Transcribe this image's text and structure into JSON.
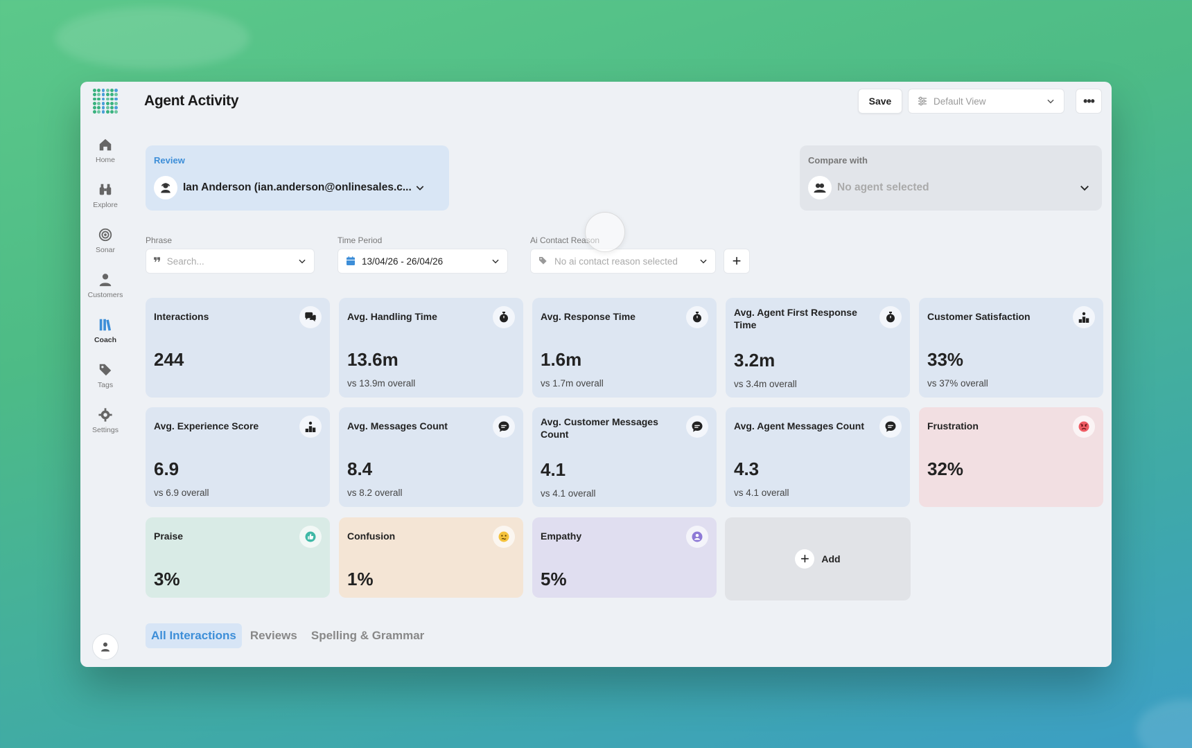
{
  "app": {
    "page_title": "Agent Activity"
  },
  "header": {
    "save_label": "Save",
    "view_label": "Default View",
    "more_label": "•••"
  },
  "sidebar": {
    "items": [
      {
        "label": "Home",
        "icon": "home-icon"
      },
      {
        "label": "Explore",
        "icon": "binoculars-icon"
      },
      {
        "label": "Sonar",
        "icon": "target-icon"
      },
      {
        "label": "Customers",
        "icon": "person-icon"
      },
      {
        "label": "Coach",
        "icon": "books-icon",
        "active": true
      },
      {
        "label": "Tags",
        "icon": "tag-icon"
      },
      {
        "label": "Settings",
        "icon": "gear-icon"
      }
    ]
  },
  "review": {
    "label": "Review",
    "agent": "Ian Anderson (ian.anderson@onlinesales.c..."
  },
  "compare": {
    "label": "Compare with",
    "placeholder": "No agent selected"
  },
  "filters": {
    "phrase": {
      "label": "Phrase",
      "placeholder": "Search..."
    },
    "time_period": {
      "label": "Time Period",
      "value": "13/04/26 - 26/04/26"
    },
    "contact_reason": {
      "label": "Ai Contact Reason",
      "placeholder": "No ai contact reason selected"
    },
    "add_label": "+"
  },
  "cards": [
    {
      "title": "Interactions",
      "value": "244",
      "sub": "",
      "icon": "chat-bubbles-icon",
      "tone": "blue"
    },
    {
      "title": "Avg. Handling Time",
      "value": "13.6m",
      "sub": "vs 13.9m overall",
      "icon": "stopwatch-icon",
      "tone": "blue"
    },
    {
      "title": "Avg. Response Time",
      "value": "1.6m",
      "sub": "vs 1.7m overall",
      "icon": "stopwatch-icon",
      "tone": "blue"
    },
    {
      "title": "Avg. Agent First Response Time",
      "value": "3.2m",
      "sub": "vs 3.4m overall",
      "icon": "stopwatch-icon",
      "tone": "blue"
    },
    {
      "title": "Customer Satisfaction",
      "value": "33%",
      "sub": "vs 37% overall",
      "icon": "podium-icon",
      "tone": "blue"
    },
    {
      "title": "Avg. Experience Score",
      "value": "6.9",
      "sub": "vs 6.9 overall",
      "icon": "podium-icon",
      "tone": "blue"
    },
    {
      "title": "Avg. Messages Count",
      "value": "8.4",
      "sub": "vs 8.2 overall",
      "icon": "message-icon",
      "tone": "blue"
    },
    {
      "title": "Avg. Customer Messages Count",
      "value": "4.1",
      "sub": "vs 4.1 overall",
      "icon": "message-icon",
      "tone": "blue"
    },
    {
      "title": "Avg. Agent Messages Count",
      "value": "4.3",
      "sub": "vs 4.1 overall",
      "icon": "message-icon",
      "tone": "blue"
    },
    {
      "title": "Frustration",
      "value": "32%",
      "sub": "",
      "icon": "angry-face-icon",
      "tone": "red"
    },
    {
      "title": "Praise",
      "value": "3%",
      "sub": "",
      "icon": "thumbs-up-icon",
      "tone": "green"
    },
    {
      "title": "Confusion",
      "value": "1%",
      "sub": "",
      "icon": "confused-face-icon",
      "tone": "orange"
    },
    {
      "title": "Empathy",
      "value": "5%",
      "sub": "",
      "icon": "empathy-icon",
      "tone": "purple"
    }
  ],
  "add_card": {
    "label": "Add"
  },
  "tabs": [
    {
      "label": "All Interactions",
      "active": true
    },
    {
      "label": "Reviews"
    },
    {
      "label": "Spelling & Grammar"
    }
  ],
  "colors": {
    "accent": "#3d8ed8",
    "card_blue": "#dde6f2",
    "card_red": "#f2dfe2",
    "card_green": "#d9ebe6",
    "card_orange": "#f4e5d5",
    "card_purple": "#e0def0"
  }
}
